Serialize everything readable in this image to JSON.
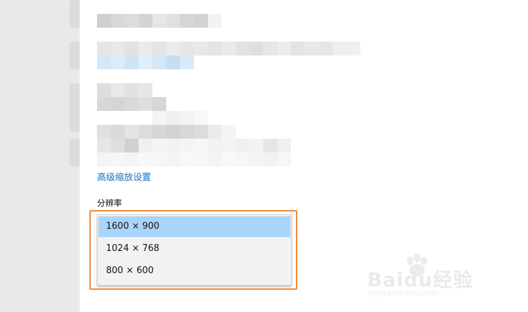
{
  "links": {
    "advanced_scaling": "高级缩放设置"
  },
  "resolution": {
    "label": "分辨率",
    "options": [
      "1600 × 900",
      "1024 × 768",
      "800 × 600"
    ],
    "selected_index": 0
  },
  "watermark": {
    "brand": "Baidu经验",
    "url": "jingyan.baidu.com"
  },
  "colors": {
    "link": "#1a6fb5",
    "selected_option": "#a9d4fb",
    "highlight_border": "#f0883a",
    "sidebar": "#e9e9e9"
  }
}
